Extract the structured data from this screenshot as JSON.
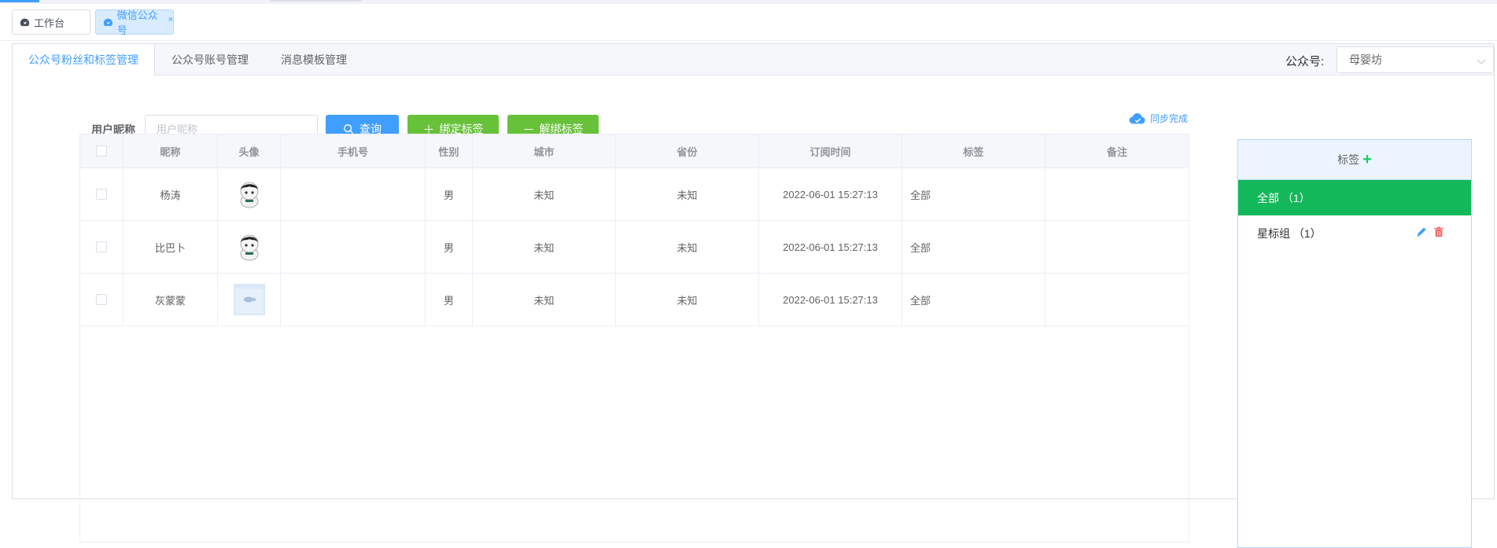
{
  "tags_view": [
    {
      "label": "工作台",
      "active": false
    },
    {
      "label": "微信公众号",
      "active": true,
      "close": "×"
    }
  ],
  "tabs": [
    {
      "label": "公众号粉丝和标签管理",
      "active": true
    },
    {
      "label": "公众号账号管理",
      "active": false
    },
    {
      "label": "消息模板管理",
      "active": false
    }
  ],
  "account": {
    "label": "公众号:",
    "selected": "母婴坊"
  },
  "search": {
    "label": "用户昵称",
    "placeholder": "用户昵称",
    "value": ""
  },
  "buttons": {
    "query": "查询",
    "bind": "绑定标签",
    "unbind": "解绑标签"
  },
  "sync": {
    "label": "同步完成"
  },
  "table": {
    "columns": [
      "",
      "昵称",
      "头像",
      "手机号",
      "性别",
      "城市",
      "省份",
      "订阅时间",
      "标签",
      "备注"
    ],
    "rows": [
      {
        "nickname": "杨涛",
        "avatar": "cartoon",
        "phone": "",
        "gender": "男",
        "city": "未知",
        "province": "未知",
        "time": "2022-06-01 15:27:13",
        "tag": "全部",
        "remark": ""
      },
      {
        "nickname": "比巴卜",
        "avatar": "cartoon",
        "phone": "",
        "gender": "男",
        "city": "未知",
        "province": "未知",
        "time": "2022-06-01 15:27:13",
        "tag": "全部",
        "remark": ""
      },
      {
        "nickname": "灰蒙蒙",
        "avatar": "placeholder",
        "phone": "",
        "gender": "男",
        "city": "未知",
        "province": "未知",
        "time": "2022-06-01 15:27:13",
        "tag": "全部",
        "remark": ""
      }
    ]
  },
  "tag_panel": {
    "title": "标签",
    "items": [
      {
        "label": "全部 （1）",
        "selected": true
      },
      {
        "label": "星标组 （1）",
        "selected": false
      }
    ]
  },
  "colors": {
    "primary": "#409eff",
    "success": "#67c23a",
    "selected_tag": "#13b85a",
    "danger": "#f56c6c"
  }
}
